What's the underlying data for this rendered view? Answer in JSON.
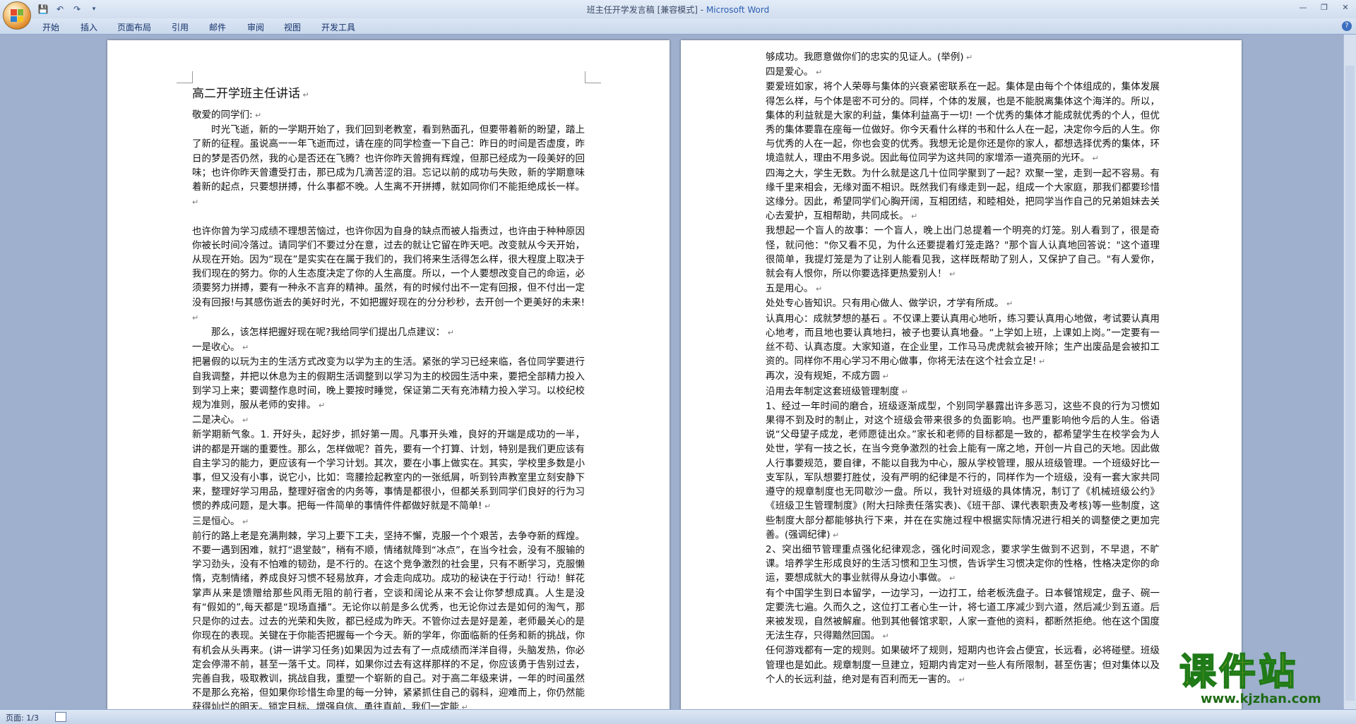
{
  "window": {
    "title_doc": "班主任开学发言稿 [兼容模式]",
    "title_sep": " - ",
    "title_app": "Microsoft Word"
  },
  "ribbon": {
    "tabs": [
      "开始",
      "插入",
      "页面布局",
      "引用",
      "邮件",
      "审阅",
      "视图",
      "开发工具"
    ]
  },
  "status": {
    "page": "页面: 1/3"
  },
  "watermark": {
    "title": "课件站",
    "url": "www.kjzhan.com"
  },
  "doc": {
    "left": [
      {
        "style": "title",
        "text": "高二开学班主任讲话"
      },
      {
        "style": "",
        "text": "敬爱的同学们:"
      },
      {
        "style": "indent",
        "text": "时光飞逝，新的一学期开始了，我们回到老教室，看到熟面孔，但要带着新的盼望，踏上了新的征程。虽说高一一年飞逝而过，请在座的同学检查一下自己：昨日的时间是否虚度，昨日的梦是否仍然，我的心是否还在飞腾？也许你昨天曾拥有辉煌，但那已经成为一段美好的回味；也许你昨天曾遭受打击，那已成为几滴苦涩的泪。忘记以前的成功与失败，新的学期意味着新的起点，只要想拼搏，什么事都不晚。人生离不开拼搏，就如同你们不能拒绝成长一样。"
      },
      {
        "style": "blank",
        "text": ""
      },
      {
        "style": "",
        "text": "也许你曾为学习成绩不理想苦恼过，也许你因为自身的缺点而被人指责过，也许由于种种原因你被长时间冷落过。请同学们不要过分在意，过去的就让它留在昨天吧。改变就从今天开始，从现在开始。因为“现在”是实实在在属于我们的，我们将来生活得怎么样，很大程度上取决于我们现在的努力。你的人生态度决定了你的人生高度。所以，一个人要想改变自己的命运，必须要努力拼搏，要有一种永不言弃的精神。虽然，有的时候付出不一定有回报，但不付出一定没有回报!与其感伤逝去的美好时光，不如把握好现在的分分秒秒，去开创一个更美好的未来!"
      },
      {
        "style": "indent",
        "text": "那么，该怎样把握好现在呢?我给同学们提出几点建议："
      },
      {
        "style": "",
        "text": "一是收心。"
      },
      {
        "style": "",
        "text": "把暑假的以玩为主的生活方式改变为以学为主的生活。紧张的学习已经来临，各位同学要进行自我调整，并把以休息为主的假期生活调整到以学习为主的校园生活中来，要把全部精力投入到学习上来；要调整作息时间，晚上要按时睡觉，保证第二天有充沛精力投入学习。以校纪校规为准则，服从老师的安排。"
      },
      {
        "style": "",
        "text": "二是决心。"
      },
      {
        "style": "",
        "text": "新学期新气象。1. 开好头，起好步，抓好第一周。凡事开头难，良好的开端是成功的一半，讲的都是开端的重要性。那么，怎样做呢？首先，要有一个打算、计划，特别是我们更应该有自主学习的能力，更应该有一个学习计划。其次，要在小事上做实在。其实，学校里多数是小事，但又没有小事，说它小，比如：弯腰捡起教室内的一张纸屑，听到铃声教室里立刻安静下来，整理好学习用品，整理好宿舍的内务等，事情是都很小，但都关系到同学们良好的行为习惯的养成问题，是大事。把每一件简单的事情件件都做好就是不简单!"
      },
      {
        "style": "",
        "text": "三是恒心。"
      },
      {
        "style": "",
        "text": "前行的路上老是充满荆棘，学习上要下工夫，坚持不懈，克服一个个艰苦，去争夺新的辉煌。不要一遇到困难，就打“退堂鼓”，稍有不顺，情绪就降到“冰点”，在当今社会，没有不服输的学习劲头，没有不怕难的韧劲，是不行的。在这个竞争激烈的社会里，只有不断学习，克服懒惰，克制情绪，养成良好习惯不轻易放弃，才会走向成功。成功的秘诀在于行动！行动！鲜花掌声从来是馈赠给那些风雨无阻的前行者，空谈和阔论从来不会让你梦想成真。人生是没有“假如的”,每天都是“现场直播”。无论你以前是多么优秀，也无论你过去是如何的淘气，那只是你的过去。过去的光荣和失败，都已经成为昨天。不管你过去是好是差，老师最关心的是你现在的表现。关键在于你能否把握每一个今天。新的学年，你面临新的任务和新的挑战，你有机会从头再来。(讲一讲学习任务)如果因为过去有了一点成绩而洋洋自得，头脑发热，你必定会停滞不前，甚至一落千丈。同样，如果你过去有这样那样的不足，你应该勇于告别过去，完善自我，吸取教训，挑战自我，重塑一个崭新的自己。对于高二年级来讲，一年的时间虽然不是那么充裕，但如果你珍惜生命里的每一分钟，紧紧抓住自己的弱科，迎难而上，你仍然能获得灿烂的明天。锁定目标、增强自信、勇往直前，我们一定能"
      }
    ],
    "right": [
      {
        "style": "",
        "text": "够成功。我愿意做你们的忠实的见证人。(举例)"
      },
      {
        "style": "",
        "text": "四是爱心。"
      },
      {
        "style": "",
        "text": "要爱班如家，将个人荣辱与集体的兴衰紧密联系在一起。集体是由每个个体组成的，集体发展得怎么样，与个体是密不可分的。同样，个体的发展，也是不能脱离集体这个海洋的。所以，集体的利益就是大家的利益，集体利益高于一切! 一个优秀的集体才能成就优秀的个人，但优秀的集体要靠在座每一位做好。你今天看什么样的书和什么人在一起，决定你今后的人生。你与优秀的人在一起，你也会变的优秀。我想无论是你还是你的家人，都想选择优秀的集体，环境造就人，理由不用多说。因此每位同学为这共同的家增添一道亮丽的光环。"
      },
      {
        "style": "",
        "text": "四海之大，学生无数。为什么就是这几十位同学聚到了一起？欢聚一堂，走到一起不容易。有缘千里来相会，无缘对面不相识。既然我们有缘走到一起，组成一个大家庭，那我们都要珍惜这缘分。因此，希望同学们心胸开阔，互相团结，和睦相处，把同学当作自己的兄弟姐妹去关心去爱护，互相帮助，共同成长。"
      },
      {
        "style": "",
        "text": "我想起一个盲人的故事：一个盲人，晚上出门总提着一个明亮的灯笼。别人看到了，很是奇怪，就问他：\"你又看不见，为什么还要提着灯笼走路？\"那个盲人认真地回答说：\"这个道理很简单，我提灯笼是为了让别人能看见我，这样既帮助了别人，又保护了自己。\"有人爱你，就会有人恨你，所以你要选择更热爱别人！"
      },
      {
        "style": "",
        "text": "五是用心。"
      },
      {
        "style": "",
        "text": "处处专心皆知识。只有用心做人、做学识，才学有所成。"
      },
      {
        "style": "",
        "text": "认真用心：成就梦想的基石 。不仅课上要认真用心地听，练习要认真用心地做，考试要认真用心地考，而且地也要认真地扫，被子也要认真地叠。“上学如上班，上课如上岗。”一定要有一丝不苟、认真态度。大家知道，在企业里，工作马马虎虎就会被开除；生产出废品是会被扣工资的。同样你不用心学习不用心做事，你将无法在这个社会立足!"
      },
      {
        "style": "",
        "text": "再次，没有规矩，不成方圆"
      },
      {
        "style": "",
        "text": "沿用去年制定这套班级管理制度"
      },
      {
        "style": "",
        "text": "1、经过一年时间的磨合，班级逐渐成型，个别同学暴露出许多恶习，这些不良的行为习惯如果得不到及时的制止，对这个班级会带来很多的负面影响。也严重影响他今后的人生。俗语说“父母望子成龙，老师愿徒出众。”家长和老师的目标都是一致的，都希望学生在校学会为人处世，学有一技之长，在当今竞争激烈的社会上能有一席之地，开创一片自己的天地。因此做人行事要规范，要自律，不能以自我为中心，服从学校管理，服从班级管理。一个班级好比一支军队，军队想要打胜仗，没有严明的纪律是不行的，同样作为一个班级，没有一套大家共同遵守的规章制度也无同歇沙一盘。所以，我针对班级的具体情况，制订了《机械班级公约》《班级卫生管理制度》(附大扫除责任落实表)、《班干部、课代表职责及考核)等一些制度，这些制度大部分都能够执行下来，并在在实施过程中根据实际情况进行相关的调整使之更加完善。(强调纪律)"
      },
      {
        "style": "",
        "text": "2、突出细节管理重点强化纪律观念，强化时间观念，要求学生做到不迟到，不早退，不旷课。培养学生形成良好的生活习惯和卫生习惯，告诉学生习惯决定你的性格，性格决定你的命运，要想成就大的事业就得从身边小事做。"
      },
      {
        "style": "",
        "text": "有个中国学生到日本留学，一边学习，一边打工，给老板洗盘子。日本餐馆规定，盘子、碗一定要洗七遍。久而久之，这位打工者心生一计，将七道工序减少到六道，然后减少到五道。后来被发现，自然被解雇。他到其他餐馆求职，人家一查他的资料，都断然拒绝。他在这个国度无法生存，只得黯然回国。"
      },
      {
        "style": "",
        "text": "任何游戏都有一定的规则。如果破坏了规则，短期内也许会占便宜，长远看，必将碰壁。班级管理也是如此。规章制度一旦建立，短期内肯定对一些人有所限制，甚至伤害；但对集体以及个人的长远利益，绝对是有百利而无一害的。"
      }
    ]
  }
}
